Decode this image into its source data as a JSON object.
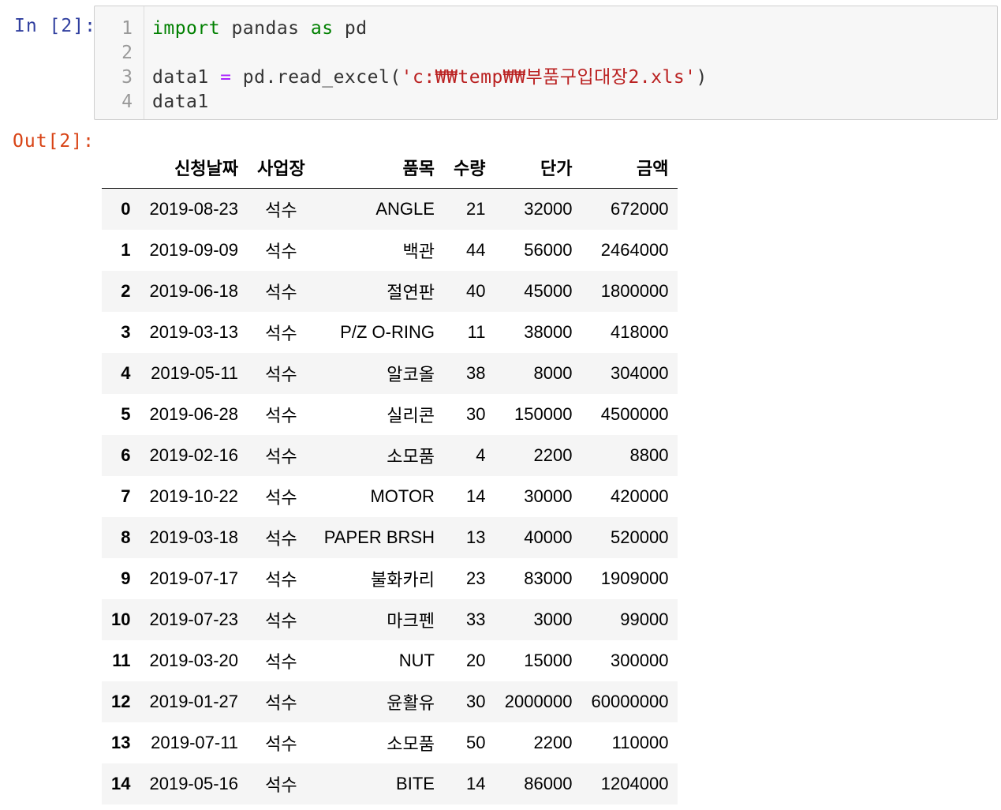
{
  "cell": {
    "in_prompt": "In [2]:",
    "out_prompt": "Out[2]:",
    "line_numbers": [
      "1",
      "2",
      "3",
      "4"
    ],
    "code": {
      "line1": {
        "kw1": "import",
        "mid": " pandas ",
        "kw2": "as",
        "end": " pd"
      },
      "line3": {
        "lhs": "data1 ",
        "op": "=",
        "call": " pd.read_excel(",
        "str": "'c:₩₩temp₩₩부품구입대장2.xls'",
        "close": ")"
      },
      "line4": "data1"
    }
  },
  "table": {
    "columns": [
      "",
      "신청날짜",
      "사업장",
      "품목",
      "수량",
      "단가",
      "금액"
    ],
    "rows": [
      [
        "0",
        "2019-08-23",
        "석수",
        "ANGLE",
        "21",
        "32000",
        "672000"
      ],
      [
        "1",
        "2019-09-09",
        "석수",
        "백관",
        "44",
        "56000",
        "2464000"
      ],
      [
        "2",
        "2019-06-18",
        "석수",
        "절연판",
        "40",
        "45000",
        "1800000"
      ],
      [
        "3",
        "2019-03-13",
        "석수",
        "P/Z O-RING",
        "11",
        "38000",
        "418000"
      ],
      [
        "4",
        "2019-05-11",
        "석수",
        "알코올",
        "38",
        "8000",
        "304000"
      ],
      [
        "5",
        "2019-06-28",
        "석수",
        "실리콘",
        "30",
        "150000",
        "4500000"
      ],
      [
        "6",
        "2019-02-16",
        "석수",
        "소모품",
        "4",
        "2200",
        "8800"
      ],
      [
        "7",
        "2019-10-22",
        "석수",
        "MOTOR",
        "14",
        "30000",
        "420000"
      ],
      [
        "8",
        "2019-03-18",
        "석수",
        "PAPER BRSH",
        "13",
        "40000",
        "520000"
      ],
      [
        "9",
        "2019-07-17",
        "석수",
        "불화카리",
        "23",
        "83000",
        "1909000"
      ],
      [
        "10",
        "2019-07-23",
        "석수",
        "마크펜",
        "33",
        "3000",
        "99000"
      ],
      [
        "11",
        "2019-03-20",
        "석수",
        "NUT",
        "20",
        "15000",
        "300000"
      ],
      [
        "12",
        "2019-01-27",
        "석수",
        "윤활유",
        "30",
        "2000000",
        "60000000"
      ],
      [
        "13",
        "2019-07-11",
        "석수",
        "소모품",
        "50",
        "2200",
        "110000"
      ],
      [
        "14",
        "2019-05-16",
        "석수",
        "BITE",
        "14",
        "86000",
        "1204000"
      ]
    ]
  },
  "colors": {
    "in_prompt": "#303f9f",
    "out_prompt": "#d84315",
    "keyword": "#008000",
    "string": "#ba2121",
    "operator": "#aa22ff"
  }
}
